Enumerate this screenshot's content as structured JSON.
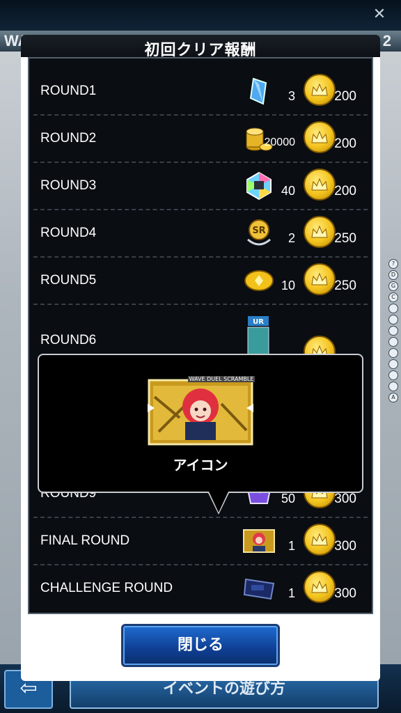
{
  "background": {
    "wave_label": "WAVE",
    "wave_number": "2",
    "howto_button": "イベントの遊び方",
    "side_markers": [
      "?",
      "D",
      "G",
      "C",
      "",
      "",
      "",
      "",
      "",
      "",
      "",
      "",
      "A"
    ]
  },
  "dialog": {
    "title": "初回クリア報酬",
    "close_label": "閉じる"
  },
  "rows": [
    {
      "label": "ROUND1",
      "item_icon": "blue-crystal-icon",
      "item_count": "3",
      "coins": "200"
    },
    {
      "label": "ROUND2",
      "item_icon": "gold-stack-icon",
      "item_count": "20000",
      "coins": "200"
    },
    {
      "label": "ROUND3",
      "item_icon": "rainbow-gem-icon",
      "item_count": "40",
      "coins": "200"
    },
    {
      "label": "ROUND4",
      "item_icon": "sr-ticket-icon",
      "item_count": "2",
      "coins": "250"
    },
    {
      "label": "ROUND5",
      "item_icon": "gold-coin-icon",
      "item_count": "10",
      "coins": "250"
    },
    {
      "label": "ROUND6",
      "item_icon": "ur-card-icon",
      "item_count": "",
      "coins": ""
    },
    {
      "label": "ROUND9",
      "item_icon": "purple-crystal-icon",
      "item_count": "50",
      "coins": "300"
    },
    {
      "label": "FINAL ROUND",
      "item_icon": "avatar-icon",
      "item_count": "1",
      "coins": "300"
    },
    {
      "label": "CHALLENGE ROUND",
      "item_icon": "card-sleeve-icon",
      "item_count": "1",
      "coins": "300"
    }
  ],
  "popup": {
    "label": "アイコン",
    "card_banner": "WAVE DUEL SCRAMBLE"
  },
  "colors": {
    "accent_blue": "#1f6bd0",
    "coin_gold": "#f3c31c",
    "panel_bg": "#0a0d12"
  }
}
